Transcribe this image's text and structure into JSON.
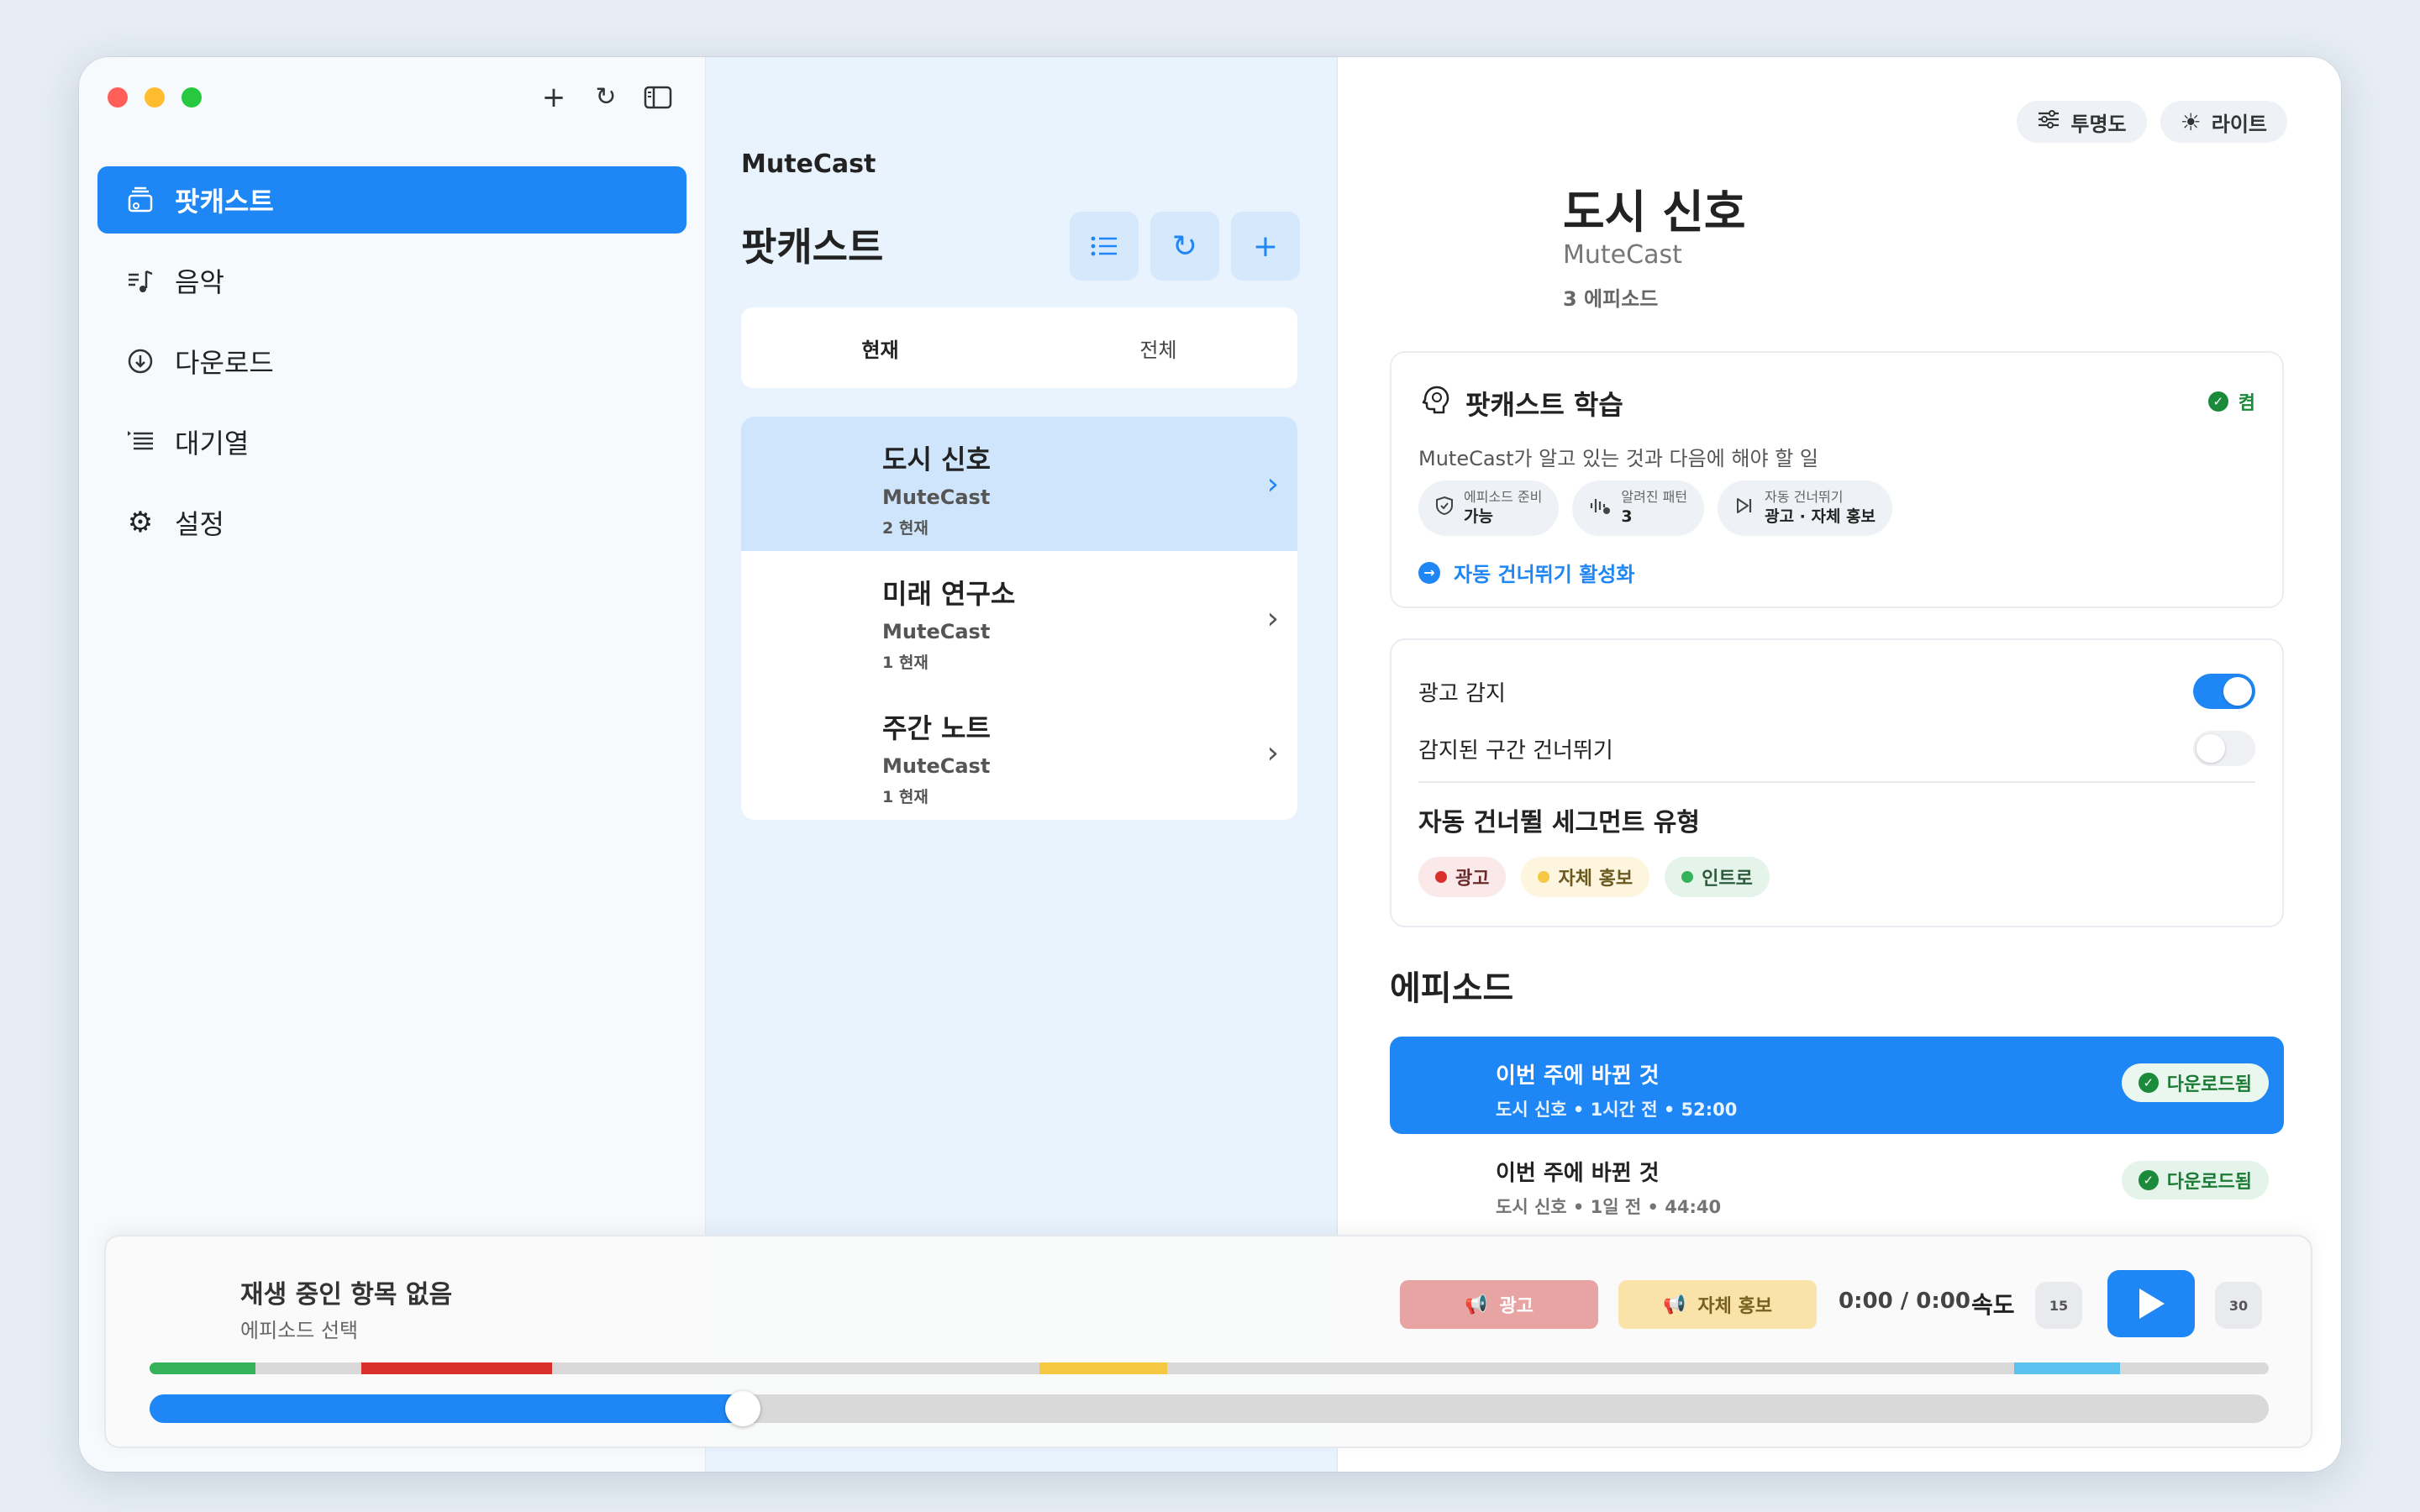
{
  "sidebar": {
    "items": [
      {
        "label": "팟캐스트",
        "icon": "podcast-stack-icon",
        "active": true
      },
      {
        "label": "음악",
        "icon": "music-note-icon",
        "active": false
      },
      {
        "label": "다운로드",
        "icon": "download-circle-icon",
        "active": false
      },
      {
        "label": "대기열",
        "icon": "queue-list-icon",
        "active": false
      },
      {
        "label": "설정",
        "icon": "gear-icon",
        "active": false
      }
    ]
  },
  "middle": {
    "app_name": "MuteCast",
    "title": "팟캐스트",
    "tabs": [
      "현재",
      "전체"
    ],
    "podcasts": [
      {
        "title": "도시 신호",
        "author": "MuteCast",
        "count": "2 현재",
        "selected": true
      },
      {
        "title": "미래 연구소",
        "author": "MuteCast",
        "count": "1 현재",
        "selected": false
      },
      {
        "title": "주간 노트",
        "author": "MuteCast",
        "count": "1 현재",
        "selected": false
      }
    ]
  },
  "detail": {
    "chips": {
      "opacity": "투명도",
      "theme": "라이트"
    },
    "title": "도시 신호",
    "author": "MuteCast",
    "episode_count": "3 에피소드",
    "learning": {
      "title": "팟캐스트 학습",
      "status": "켬",
      "subtitle": "MuteCast가 알고 있는 것과 다음에 해야 할 일",
      "pills": [
        {
          "label": "에피소드 준비",
          "value": "가능",
          "icon": "shield-check-icon"
        },
        {
          "label": "알려진 패턴",
          "value": "3",
          "icon": "waveform-icon"
        },
        {
          "label": "자동 건너뛰기",
          "value": "광고 · 자체 홍보",
          "icon": "skip-forward-icon"
        }
      ],
      "link": "자동 건너뛰기 활성화"
    },
    "settings": {
      "ad_detect_label": "광고 감지",
      "ad_detect_on": true,
      "skip_label": "감지된 구간 건너뛰기",
      "skip_on": false,
      "segment_heading": "자동 건너뛸 세그먼트 유형",
      "tags": [
        {
          "label": "광고",
          "color": "#d9302c"
        },
        {
          "label": "자체 홍보",
          "color": "#f5c842"
        },
        {
          "label": "인트로",
          "color": "#34b35a"
        }
      ]
    },
    "episodes_heading": "에피소드",
    "episodes": [
      {
        "title": "이번 주에 바뀐 것",
        "meta": "도시 신호 • 1시간 전 • 52:00",
        "badge": "다운로드됨",
        "selected": true
      },
      {
        "title": "이번 주에 바뀐 것",
        "meta": "도시 신호 • 1일 전 • 44:40",
        "badge": "다운로드됨",
        "selected": false
      }
    ]
  },
  "player": {
    "title": "재생 중인 항목 없음",
    "subtitle": "에피소드 선택",
    "ad_button": "광고",
    "promo_button": "자체 홍보",
    "time": "0:00 / 0:00",
    "speed_label": "속도",
    "skip_back": "15",
    "skip_forward": "30",
    "progress": 0.28,
    "segments": [
      {
        "start": 0.0,
        "end": 0.05,
        "color": "#34b35a"
      },
      {
        "start": 0.1,
        "end": 0.19,
        "color": "#d9302c"
      },
      {
        "start": 0.42,
        "end": 0.48,
        "color": "#f5c842"
      },
      {
        "start": 0.88,
        "end": 0.93,
        "color": "#5bc2f0"
      }
    ]
  },
  "colors": {
    "accent": "#1e86f5"
  }
}
